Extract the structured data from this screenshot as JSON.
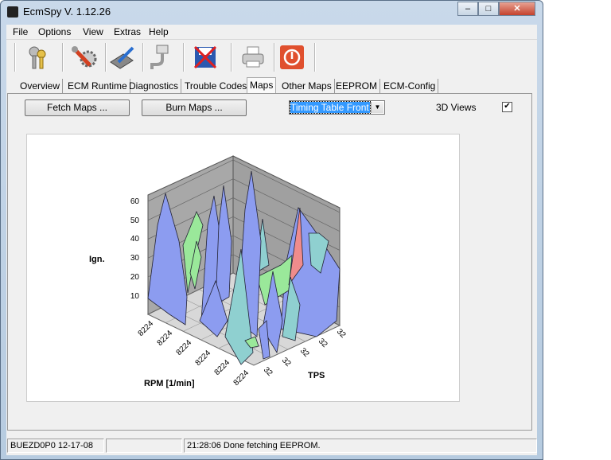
{
  "window": {
    "title": "EcmSpy V. 1.12.26",
    "controls": [
      "minimize",
      "maximize",
      "close"
    ]
  },
  "menu": [
    "File",
    "Options",
    "View",
    "Extras",
    "Help"
  ],
  "toolbar": [
    {
      "icon": "keys-icon"
    },
    {
      "icon": "settings-wrench-gear-icon"
    },
    {
      "icon": "chip-pencil-icon"
    },
    {
      "icon": "serial-cable-icon"
    },
    {
      "icon": "disk-crossed-icon"
    },
    {
      "icon": "printer-icon"
    },
    {
      "icon": "power-icon"
    }
  ],
  "tabs": [
    "Overview",
    "ECM Runtime",
    "Diagnostics",
    "Trouble Codes",
    "Maps",
    "Other Maps",
    "EEPROM",
    "ECM-Config"
  ],
  "active_tab": "Maps",
  "maps": {
    "fetch_label": "Fetch Maps ...",
    "burn_label": "Burn Maps ...",
    "table_select": "Timing Table Front",
    "views_label": "3D Views",
    "views_checked": true
  },
  "chart_data": {
    "type": "surface3d",
    "zlabel": "Ign.",
    "xlabel": "RPM [1/min]",
    "ylabel": "TPS",
    "z_ticks": [
      "60",
      "50",
      "40",
      "30",
      "20",
      "10"
    ],
    "x_ticks": [
      "8224",
      "8224",
      "8224",
      "8224",
      "8224",
      "8224"
    ],
    "y_ticks": [
      "32",
      "32",
      "32",
      "32",
      "32"
    ],
    "colors": {
      "low": "#8c9cf0",
      "mid": "#9ae89a",
      "high": "#f08c8c",
      "teal": "#8fd0d0"
    }
  },
  "status": {
    "ecu": "BUEZD0P0 12-17-08",
    "middle": "",
    "message": "21:28:06 Done fetching EEPROM."
  }
}
